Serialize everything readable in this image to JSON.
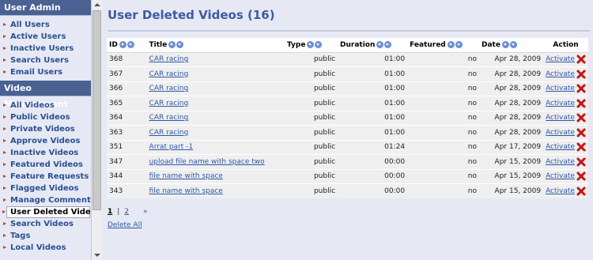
{
  "sidebar": {
    "user_admin": {
      "header": "User Admin",
      "items": [
        {
          "label": "All Users"
        },
        {
          "label": "Active Users"
        },
        {
          "label": "Inactive Users"
        },
        {
          "label": "Search Users"
        },
        {
          "label": "Email Users"
        }
      ]
    },
    "video_management": {
      "header": "Video Management",
      "items": [
        {
          "label": "All Videos"
        },
        {
          "label": "Public Videos"
        },
        {
          "label": "Private Videos"
        },
        {
          "label": "Approve Videos"
        },
        {
          "label": "Inactive Videos"
        },
        {
          "label": "Featured Videos"
        },
        {
          "label": "Feature Requests"
        },
        {
          "label": "Flagged Videos"
        },
        {
          "label": "Manage Comments"
        },
        {
          "label": "User Deleted Videos",
          "active": true
        },
        {
          "label": "Search Videos"
        },
        {
          "label": "Tags"
        },
        {
          "label": "Local Videos"
        }
      ]
    }
  },
  "main": {
    "title": "User Deleted Videos (16)",
    "columns": {
      "id": "ID",
      "title": "Title",
      "type": "Type",
      "duration": "Duration",
      "featured": "Featured",
      "date": "Date",
      "action": "Action"
    },
    "rows": [
      {
        "id": "368",
        "title": "CAR racing",
        "type": "public",
        "duration": "01:00",
        "featured": "no",
        "date": "Apr 28, 2009",
        "action": "Activate"
      },
      {
        "id": "367",
        "title": "CAR racing",
        "type": "public",
        "duration": "01:00",
        "featured": "no",
        "date": "Apr 28, 2009",
        "action": "Activate"
      },
      {
        "id": "366",
        "title": "CAR racing",
        "type": "public",
        "duration": "01:00",
        "featured": "no",
        "date": "Apr 28, 2009",
        "action": "Activate"
      },
      {
        "id": "365",
        "title": "CAR racing",
        "type": "public",
        "duration": "01:00",
        "featured": "no",
        "date": "Apr 28, 2009",
        "action": "Activate"
      },
      {
        "id": "364",
        "title": "CAR racing",
        "type": "public",
        "duration": "01:00",
        "featured": "no",
        "date": "Apr 28, 2009",
        "action": "Activate"
      },
      {
        "id": "363",
        "title": "CAR racing",
        "type": "public",
        "duration": "01:00",
        "featured": "no",
        "date": "Apr 28, 2009",
        "action": "Activate"
      },
      {
        "id": "351",
        "title": "Arrat part -1",
        "type": "public",
        "duration": "01:24",
        "featured": "no",
        "date": "Apr 17, 2009",
        "action": "Activate"
      },
      {
        "id": "347",
        "title": "upload file name with space two",
        "type": "public",
        "duration": "00:00",
        "featured": "no",
        "date": "Apr 15, 2009",
        "action": "Activate"
      },
      {
        "id": "344",
        "title": "file name with space",
        "type": "public",
        "duration": "00:00",
        "featured": "no",
        "date": "Apr 15, 2009",
        "action": "Activate"
      },
      {
        "id": "343",
        "title": "file name with space",
        "type": "public",
        "duration": "00:00",
        "featured": "no",
        "date": "Apr 15, 2009",
        "action": "Activate"
      }
    ],
    "pager": {
      "current": "1",
      "separator": "|",
      "page2": "2",
      "next": "»"
    },
    "delete_all": "Delete All"
  },
  "colors": {
    "header_bg": "#4a6292",
    "link": "#2c59a8",
    "title": "#3d5aa6",
    "bullet": "#e0302a",
    "delete": "#cc1111"
  },
  "icons": {
    "sort_asc": "sort-ascending-icon",
    "sort_desc": "sort-descending-icon",
    "delete": "red-x-delete-icon"
  }
}
